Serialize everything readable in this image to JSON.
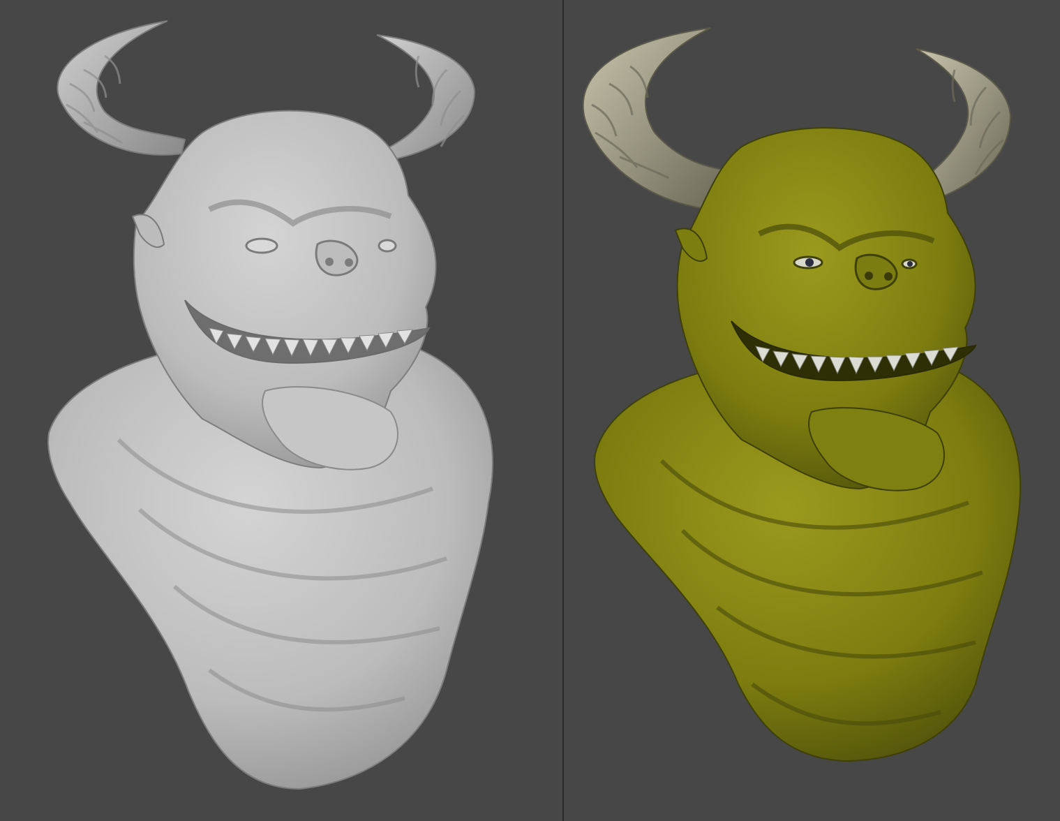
{
  "viewports": [
    {
      "id": "clay",
      "shading": "clay",
      "colors": {
        "background": "#474747",
        "skin": "#c9c9c9",
        "skin_shadow": "#8e8e8e",
        "horn": "#bdbdbd",
        "horn_shadow": "#7a7a7a",
        "teeth": "#e2e2e2"
      }
    },
    {
      "id": "painted",
      "shading": "polypaint",
      "colors": {
        "background": "#474747",
        "skin": "#8a8a12",
        "skin_shadow": "#4e500a",
        "horn": "#b7b39a",
        "horn_shadow": "#5f5c4c",
        "teeth": "#dcdcd4",
        "eye": "#2b2e3e"
      }
    }
  ]
}
